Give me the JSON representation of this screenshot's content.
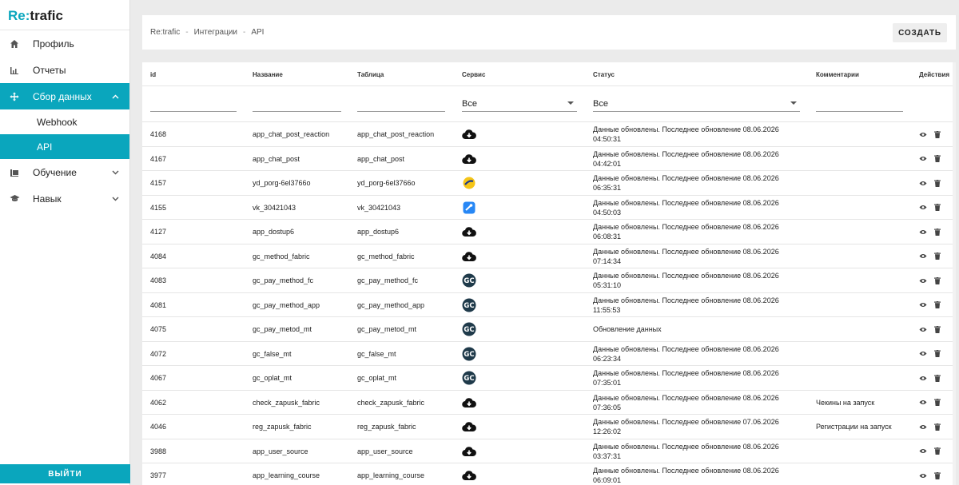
{
  "brand": {
    "prefix": "Re:",
    "name": "trafic"
  },
  "sidebar": {
    "items": [
      {
        "label": "Профиль",
        "icon": "home-icon"
      },
      {
        "label": "Отчеты",
        "icon": "bar-chart-icon"
      },
      {
        "label": "Сбор данных",
        "icon": "move-arrows-icon",
        "expanded": true
      },
      {
        "label": "Обучение",
        "icon": "library-icon"
      },
      {
        "label": "Навык",
        "icon": "graduation-cap-icon"
      }
    ],
    "sub_items": [
      {
        "label": "Webhook"
      },
      {
        "label": "API",
        "active": true
      }
    ],
    "logout_label": "ВЫЙТИ"
  },
  "breadcrumb": [
    "Re:trafic",
    "Интеграции",
    "API"
  ],
  "toolbar": {
    "create_label": "СОЗДАТЬ"
  },
  "table": {
    "columns": [
      "id",
      "Название",
      "Таблица",
      "Сервис",
      "Статус",
      "Комментарии",
      "Действия"
    ],
    "filters": {
      "service": "Все",
      "status": "Все"
    },
    "rows": [
      {
        "id": "4168",
        "name": "app_chat_post_reaction",
        "table": "app_chat_post_reaction",
        "service": "cloud",
        "status": "Данные обновлены. Последнее обновление 08.06.2026 04:50:31",
        "comment": ""
      },
      {
        "id": "4167",
        "name": "app_chat_post",
        "table": "app_chat_post",
        "service": "cloud",
        "status": "Данные обновлены. Последнее обновление 08.06.2026 04:42:01",
        "comment": ""
      },
      {
        "id": "4157",
        "name": "yd_porg-6el3766o",
        "table": "yd_porg-6el3766o",
        "service": "yandex",
        "status": "Данные обновлены. Последнее обновление 08.06.2026 06:35:31",
        "comment": ""
      },
      {
        "id": "4155",
        "name": "vk_30421043",
        "table": "vk_30421043",
        "service": "vk",
        "status": "Данные обновлены. Последнее обновление 08.06.2026 04:50:03",
        "comment": ""
      },
      {
        "id": "4127",
        "name": "app_dostup6",
        "table": "app_dostup6",
        "service": "cloud",
        "status": "Данные обновлены. Последнее обновление 08.06.2026 06:08:31",
        "comment": ""
      },
      {
        "id": "4084",
        "name": "gc_method_fabric",
        "table": "gc_method_fabric",
        "service": "cloud",
        "status": "Данные обновлены. Последнее обновление 08.06.2026 07:14:34",
        "comment": ""
      },
      {
        "id": "4083",
        "name": "gc_pay_method_fc",
        "table": "gc_pay_method_fc",
        "service": "gc",
        "status": "Данные обновлены. Последнее обновление 08.06.2026 05:31:10",
        "comment": ""
      },
      {
        "id": "4081",
        "name": "gc_pay_method_app",
        "table": "gc_pay_method_app",
        "service": "gc",
        "status": "Данные обновлены. Последнее обновление 08.06.2026 11:55:53",
        "comment": ""
      },
      {
        "id": "4075",
        "name": "gc_pay_metod_mt",
        "table": "gc_pay_metod_mt",
        "service": "gc",
        "status": "Обновление данных",
        "comment": ""
      },
      {
        "id": "4072",
        "name": "gc_false_mt",
        "table": "gc_false_mt",
        "service": "gc",
        "status": "Данные обновлены. Последнее обновление 08.06.2026 06:23:34",
        "comment": ""
      },
      {
        "id": "4067",
        "name": "gc_oplat_mt",
        "table": "gc_oplat_mt",
        "service": "gc",
        "status": "Данные обновлены. Последнее обновление 08.06.2026 07:35:01",
        "comment": ""
      },
      {
        "id": "4062",
        "name": "check_zapusk_fabric",
        "table": "check_zapusk_fabric",
        "service": "cloud",
        "status": "Данные обновлены. Последнее обновление 08.06.2026 07:36:05",
        "comment": "Чекины на запуск"
      },
      {
        "id": "4046",
        "name": "reg_zapusk_fabric",
        "table": "reg_zapusk_fabric",
        "service": "cloud",
        "status": "Данные обновлены. Последнее обновление 07.06.2026 12:26:02",
        "comment": "Регистрации на запуск"
      },
      {
        "id": "3988",
        "name": "app_user_source",
        "table": "app_user_source",
        "service": "cloud",
        "status": "Данные обновлены. Последнее обновление 08.06.2026 03:37:31",
        "comment": ""
      },
      {
        "id": "3977",
        "name": "app_learning_course",
        "table": "app_learning_course",
        "service": "cloud",
        "status": "Данные обновлены. Последнее обновление 08.06.2026 06:09:01",
        "comment": ""
      }
    ]
  },
  "colors": {
    "accent": "#0aa6bd",
    "yandex": "#f5c518",
    "vk": "#2787f5",
    "gc": "#1f3a4a"
  }
}
